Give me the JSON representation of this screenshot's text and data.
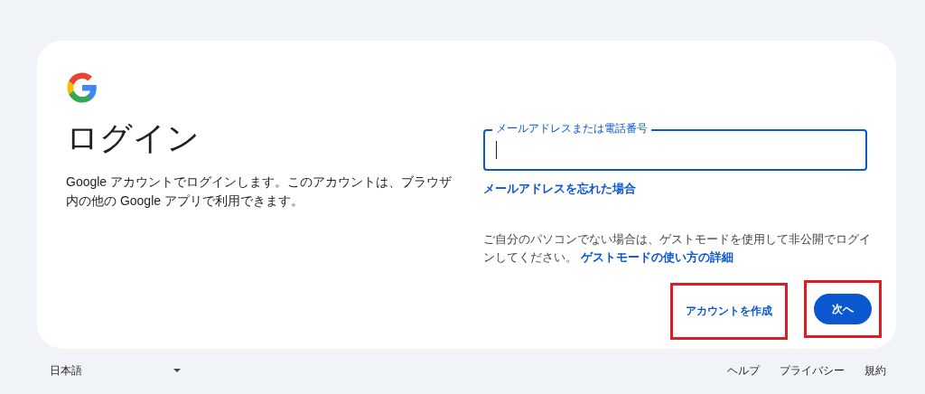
{
  "title": "ログイン",
  "description": "Google アカウントでログインします。このアカウントは、ブラウザ内の他の Google アプリで利用できます。",
  "email_field": {
    "label": "メールアドレスまたは電話番号",
    "focused": true
  },
  "forgot_link": "メールアドレスを忘れた場合",
  "guest_notice": {
    "text": "ご自分のパソコンでない場合は、ゲストモードを使用して非公開でログインしてください。",
    "link": "ゲストモードの使い方の詳細"
  },
  "buttons": [
    {
      "kind": "text",
      "label": "アカウントを作成",
      "highlighted": true
    },
    {
      "kind": "filled",
      "label": "次へ",
      "highlighted": true
    }
  ],
  "footer": {
    "language": "日本語",
    "links": [
      "ヘルプ",
      "プライバシー",
      "規約"
    ]
  }
}
